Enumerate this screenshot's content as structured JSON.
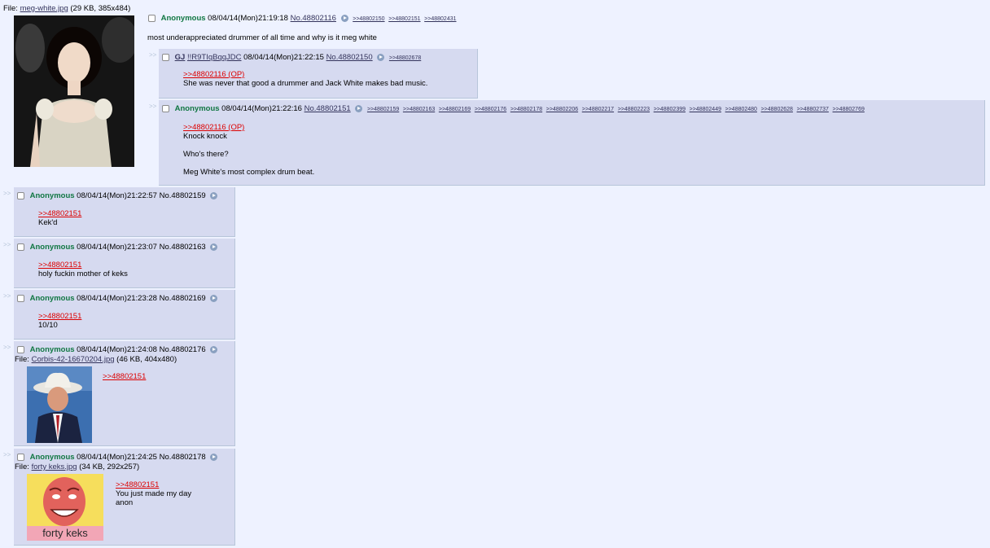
{
  "op": {
    "file_label": "File:",
    "file_name": "meg-white.jpg",
    "file_meta": "(29 KB, 385x484)",
    "name": "Anonymous",
    "datetime": "08/04/14(Mon)21:19:18",
    "no": "No.48802116",
    "backlinks": [
      ">>48802150",
      ">>48802151",
      ">>48802431"
    ],
    "comment": "most underappreciated drummer of all time and why is it meg white"
  },
  "arrow_glyph": ">>",
  "replies": [
    {
      "name": "GJ",
      "trip": "!!R9TIqBqqJDC",
      "datetime": "08/04/14(Mon)21:22:15",
      "no": "No.48802150",
      "backlinks": [
        ">>48802678"
      ],
      "quote": ">>48802116 (OP)",
      "lines": [
        "She was never that good a drummer and Jack White makes bad music."
      ]
    },
    {
      "name": "Anonymous",
      "datetime": "08/04/14(Mon)21:22:16",
      "no": "No.48802151",
      "backlinks": [
        ">>48802159",
        ">>48802163",
        ">>48802169",
        ">>48802176",
        ">>48802178",
        ">>48802206",
        ">>48802217",
        ">>48802223",
        ">>48802399",
        ">>48802449",
        ">>48802480",
        ">>48802628",
        ">>48802737",
        ">>48802769"
      ],
      "quote": ">>48802116 (OP)",
      "lines": [
        "Knock knock",
        "Who's there?",
        "Meg White's most complex drum beat."
      ]
    },
    {
      "name": "Anonymous",
      "datetime": "08/04/14(Mon)21:22:57",
      "no": "No.48802159",
      "quote": ">>48802151",
      "lines": [
        "Kek'd"
      ]
    },
    {
      "name": "Anonymous",
      "datetime": "08/04/14(Mon)21:23:07",
      "no": "No.48802163",
      "quote": ">>48802151",
      "lines": [
        "holy fuckin mother of keks"
      ]
    },
    {
      "name": "Anonymous",
      "datetime": "08/04/14(Mon)21:23:28",
      "no": "No.48802169",
      "quote": ">>48802151",
      "lines": [
        "10/10"
      ]
    },
    {
      "name": "Anonymous",
      "datetime": "08/04/14(Mon)21:24:08",
      "no": "No.48802176",
      "file_name": "Corbis-42-16670204.jpg",
      "file_meta": "(46 KB, 404x480)",
      "quote": ">>48802151",
      "lines": []
    },
    {
      "name": "Anonymous",
      "datetime": "08/04/14(Mon)21:24:25",
      "no": "No.48802178",
      "file_name": "forty keks.jpg",
      "file_meta": "(34 KB, 292x257)",
      "quote": ">>48802151",
      "lines": [
        "You just made my day",
        "anon"
      ],
      "image_caption": "forty keks"
    }
  ]
}
